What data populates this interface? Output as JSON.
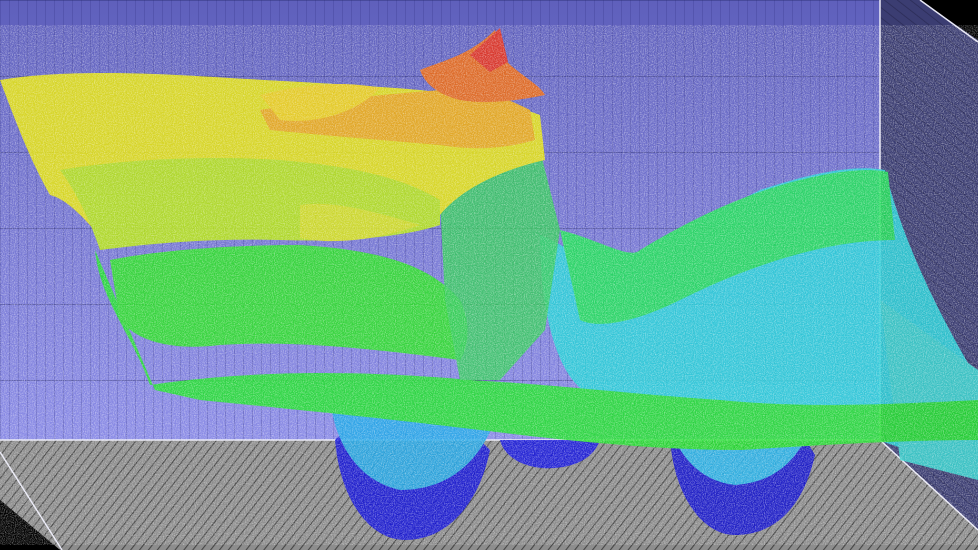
{
  "scene": {
    "type": "3d-point-cloud",
    "colormap": "jet",
    "colors": {
      "background": "#000000",
      "back_wall": "#7d7ed8",
      "back_wall_dark": "#5c5db3",
      "grid_line": "#2a2b66",
      "side_wall": "#3d3f74",
      "floor": "#8c8c8c",
      "floor_line": "#4a4a4a",
      "frame_edge": "#e8e8f5",
      "low_value": "#1616d8",
      "mid_low_value": "#2ad6e8",
      "mid_value": "#22e02a",
      "mid_high_value": "#eaea10",
      "high_value": "#e8321a"
    }
  }
}
